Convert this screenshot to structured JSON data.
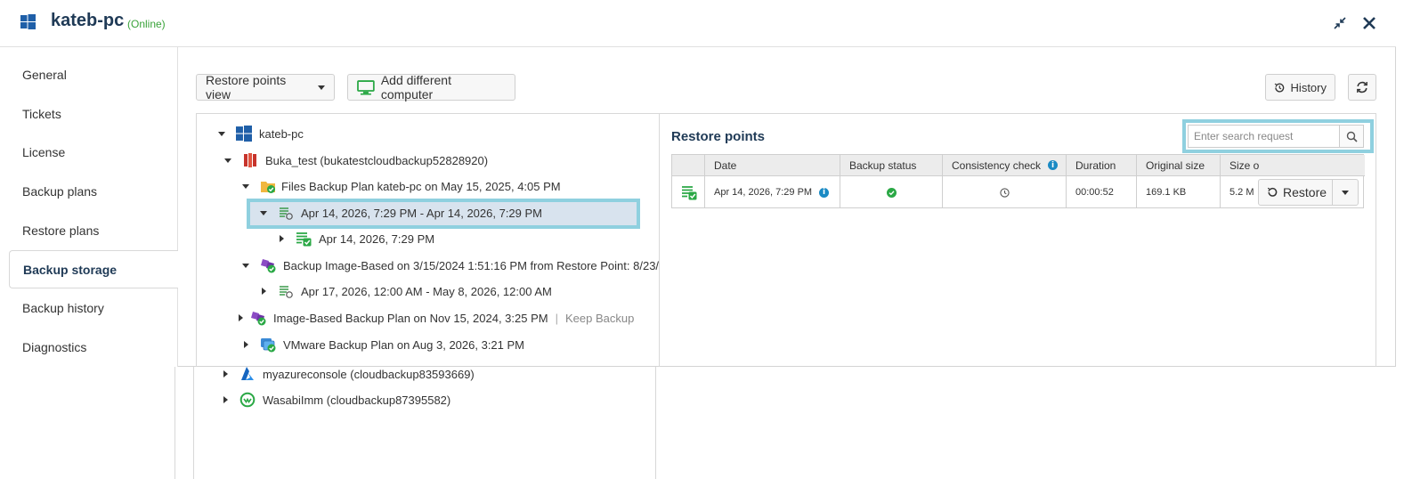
{
  "header": {
    "title": "kateb-pc",
    "status": "(Online)",
    "icons": {
      "logo": "windows-icon",
      "minimize": "collapse-icon",
      "close": "close-icon"
    }
  },
  "sidebar": {
    "items": [
      {
        "label": "General"
      },
      {
        "label": "Tickets"
      },
      {
        "label": "License"
      },
      {
        "label": "Backup plans"
      },
      {
        "label": "Restore plans"
      },
      {
        "label": "Backup storage",
        "active": true
      },
      {
        "label": "Backup history"
      },
      {
        "label": "Diagnostics"
      }
    ]
  },
  "toolbar": {
    "view_select": "Restore points view",
    "add_computer": "Add different computer",
    "history": "History"
  },
  "tree": {
    "root": "kateb-pc",
    "storage": "Buka_test (bukatestcloudbackup52828920)",
    "files_plan": "Files Backup Plan kateb-pc on May 15, 2025, 4:05 PM",
    "range1": "Apr 14, 2026, 7:29 PM - Apr 14, 2026, 7:29 PM",
    "point1": "Apr 14, 2026, 7:29 PM",
    "image_plan": "Backup Image-Based on 3/15/2024 1:51:16 PM from Restore Point: 8/23/",
    "range2": "Apr 17, 2026, 12:00 AM - May 8, 2026, 12:00 AM",
    "image_plan2": "Image-Based Backup Plan on Nov 15, 2024, 3:25 PM",
    "image_plan2_note": "Keep Backup for",
    "vmware_plan": "VMware Backup Plan on Aug 3, 2026, 3:21 PM",
    "azure": "myazureconsole (cloudbackup83593669)",
    "wasabi": "WasabiImm (cloudbackup87395582)"
  },
  "restore_points": {
    "title": "Restore points",
    "search_placeholder": "Enter search request",
    "columns": [
      "Date",
      "Backup status",
      "Consistency check",
      "Duration",
      "Original size",
      "Size o"
    ],
    "row": {
      "date": "Apr 14, 2026, 7:29 PM",
      "backup_status": "success",
      "consistency_check": "pending",
      "duration": "00:00:52",
      "original_size": "169.1 KB",
      "size": "5.2 M"
    },
    "restore_label": "Restore"
  },
  "colors": {
    "accent": "#1f3a56",
    "online": "#3aa33a",
    "highlight": "#8fd0df",
    "selected": "#d8e3ee",
    "ok": "#2aa845"
  }
}
